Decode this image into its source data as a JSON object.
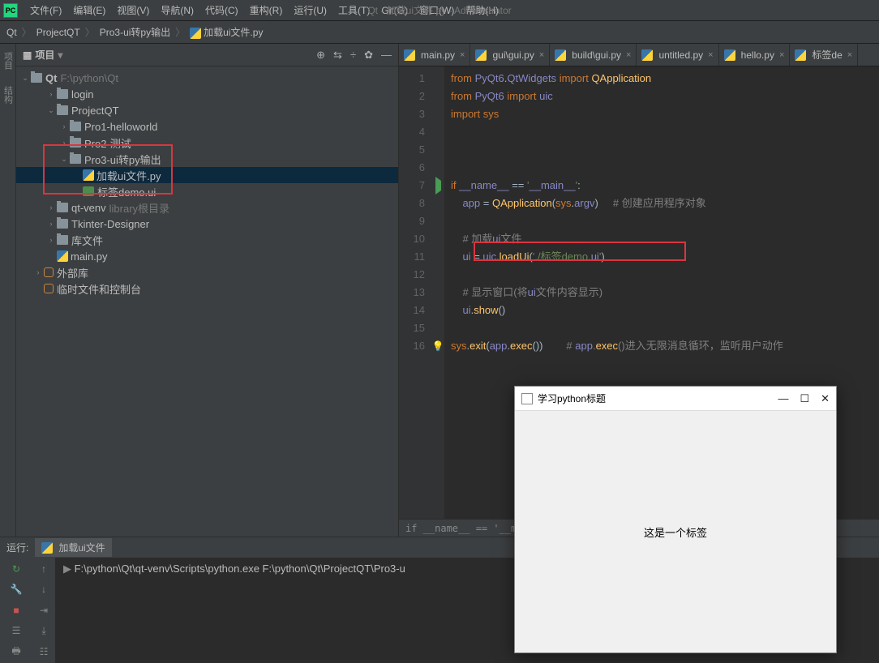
{
  "window": {
    "title": "Qt - 加载ui文件.py - Administrator"
  },
  "menus": [
    "文件(F)",
    "编辑(E)",
    "视图(V)",
    "导航(N)",
    "代码(C)",
    "重构(R)",
    "运行(U)",
    "工具(T)",
    "Git(G)",
    "窗口(W)",
    "帮助(H)"
  ],
  "breadcrumbs": [
    "Qt",
    "ProjectQT",
    "Pro3-ui转py输出",
    "加载ui文件.py"
  ],
  "sidebar": {
    "title": "项目",
    "root": "Qt",
    "root_path": "F:\\python\\Qt",
    "items": [
      {
        "label": "login",
        "depth": 2,
        "expander": "›",
        "type": "folder"
      },
      {
        "label": "ProjectQT",
        "depth": 2,
        "expander": "⌄",
        "type": "folder"
      },
      {
        "label": "Pro1-helloworld",
        "depth": 3,
        "expander": "›",
        "type": "folder"
      },
      {
        "label": "Pro2-测试",
        "depth": 3,
        "expander": "›",
        "type": "folder"
      },
      {
        "label": "Pro3-ui转py输出",
        "depth": 3,
        "expander": "⌄",
        "type": "folder"
      },
      {
        "label": "加载ui文件.py",
        "depth": 4,
        "expander": "",
        "type": "py",
        "selected": true
      },
      {
        "label": "标签demo.ui",
        "depth": 4,
        "expander": "",
        "type": "ui"
      },
      {
        "label": "qt-venv",
        "depth": 2,
        "expander": "›",
        "type": "folder",
        "suffix": "library根目录"
      },
      {
        "label": "Tkinter-Designer",
        "depth": 2,
        "expander": "›",
        "type": "folder"
      },
      {
        "label": "库文件",
        "depth": 2,
        "expander": "›",
        "type": "folder"
      },
      {
        "label": "main.py",
        "depth": 2,
        "expander": "",
        "type": "py"
      },
      {
        "label": "外部库",
        "depth": 1,
        "expander": "›",
        "type": "lib"
      },
      {
        "label": "临时文件和控制台",
        "depth": 1,
        "expander": "",
        "type": "lib"
      }
    ]
  },
  "tabs": [
    {
      "label": "main.py",
      "active": false
    },
    {
      "label": "gui\\gui.py",
      "active": false
    },
    {
      "label": "build\\gui.py",
      "active": false
    },
    {
      "label": "untitled.py",
      "active": false
    },
    {
      "label": "hello.py",
      "active": false
    },
    {
      "label": "标签de",
      "active": false
    }
  ],
  "code": {
    "lines": [
      "from PyQt6.QtWidgets import QApplication",
      "from PyQt6 import uic",
      "import sys",
      "",
      "",
      "",
      "if __name__ == '__main__':",
      "    app = QApplication(sys.argv)     # 创建应用程序对象",
      "",
      "    # 加载ui文件",
      "    ui = uic.loadUi('./标签demo.ui')",
      "",
      "    # 显示窗口(将ui文件内容显示)",
      "    ui.show()",
      "",
      "sys.exit(app.exec())        # app.exec()进入无限消息循环，监听用户动作"
    ],
    "breadcrumb": "if __name__ == '__main…"
  },
  "run": {
    "label": "运行:",
    "config": "加载ui文件",
    "output": "F:\\python\\Qt\\qt-venv\\Scripts\\python.exe F:\\python\\Qt\\ProjectQT\\Pro3-u"
  },
  "dialog": {
    "title": "学习python标题",
    "body": "这是一个标签"
  }
}
